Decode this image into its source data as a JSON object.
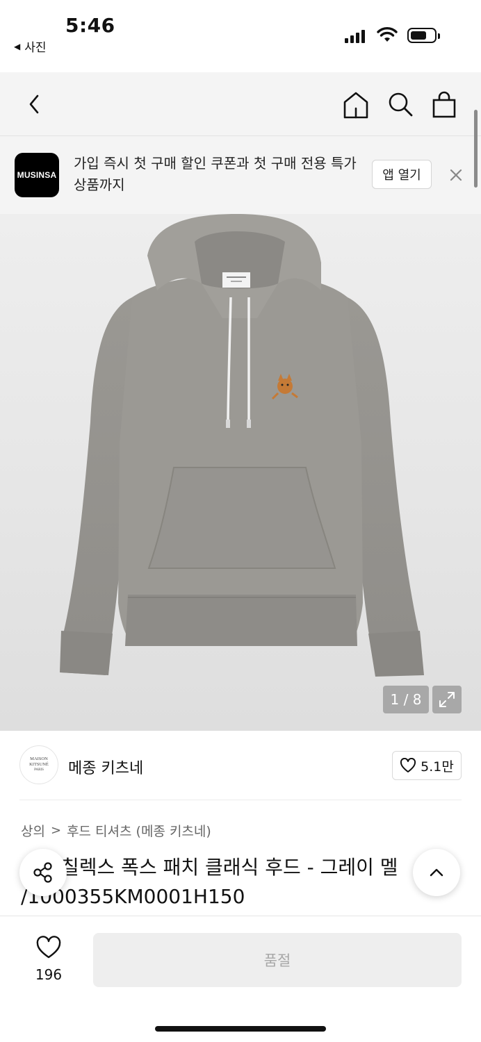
{
  "status_bar": {
    "time": "5:46",
    "back_app": "사진",
    "back_arrow": "◀"
  },
  "nav": {
    "back_icon": "chevron-left-icon",
    "home_icon": "home-icon",
    "search_icon": "search-icon",
    "cart_icon": "shopping-bag-icon"
  },
  "banner": {
    "logo_text": "MUSINSA",
    "text": "가입 즉시 첫 구매 할인 쿠폰과 첫 구매 전용 특가 상품까지",
    "open_app": "앱 열기",
    "close_icon": "close-icon"
  },
  "product_image": {
    "counter": "1 / 8",
    "expand_icon": "expand-icon"
  },
  "brand": {
    "logo_text_1": "MAISON KITSUNÉ",
    "logo_text_2": "PARIS",
    "name": "메종 키츠네",
    "likes": "5.1만"
  },
  "breadcrumb": {
    "category": "상의",
    "separator": ">",
    "subcategory": "후드 티셔츠 (메종 키츠네)"
  },
  "product": {
    "title_line1": "칠렉스 폭스 패치 클래식 후드 - 그레이 멜",
    "title_line2": "/1000355KM0001H150"
  },
  "bottom_bar": {
    "wish_count": "196",
    "soldout_label": "품절"
  },
  "colors": {
    "banner_bg": "#f4f4f4",
    "image_bg": "#e8e8e8",
    "soldout_bg": "#eeeeee",
    "soldout_text": "#a7a7a7"
  }
}
